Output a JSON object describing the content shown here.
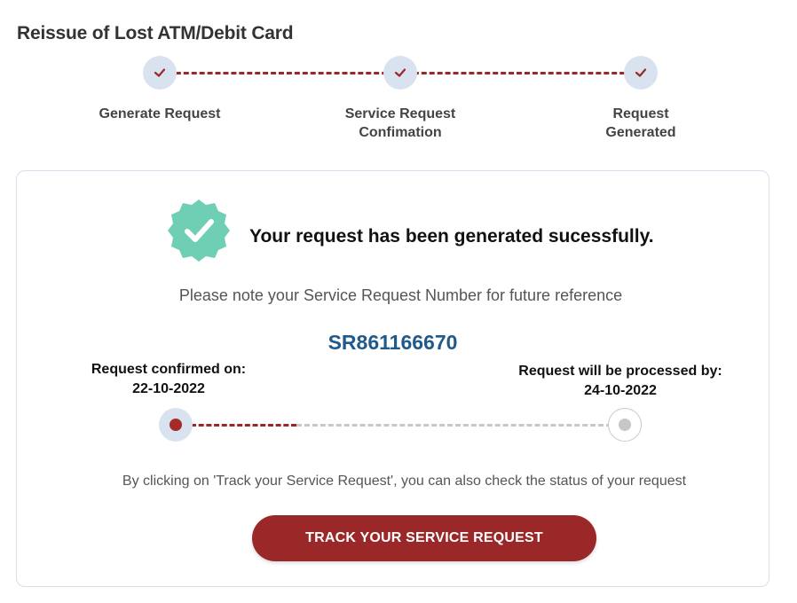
{
  "page": {
    "title": "Reissue of Lost ATM/Debit Card"
  },
  "stepper": {
    "steps": [
      {
        "label_line1": "Generate Request",
        "label_line2": "",
        "status": "complete"
      },
      {
        "label_line1": "Service Request",
        "label_line2": "Confimation",
        "status": "complete"
      },
      {
        "label_line1": "Request",
        "label_line2": "Generated",
        "status": "complete"
      }
    ]
  },
  "result": {
    "success_message": "Your request has been generated sucessfully.",
    "note": "Please note your Service Request Number for future reference",
    "sr_number": "SR861166670",
    "confirmed_label": "Request confirmed on:",
    "confirmed_date": "22-10-2022",
    "processed_label": "Request will be processed by:",
    "processed_date": "24-10-2022",
    "progress_fraction": 0.25,
    "hint": "By clicking on 'Track your Service Request', you can also check the status of your request",
    "track_button_label": "TRACK YOUR SERVICE REQUEST"
  },
  "icons": {
    "step_icon": "check-icon",
    "badge_icon": "verified-badge-icon"
  },
  "colors": {
    "brand": "#9b2828",
    "sr_number": "#1f5a8a",
    "badge": "#6fcfb4",
    "step_circle": "#d9e3f0"
  }
}
